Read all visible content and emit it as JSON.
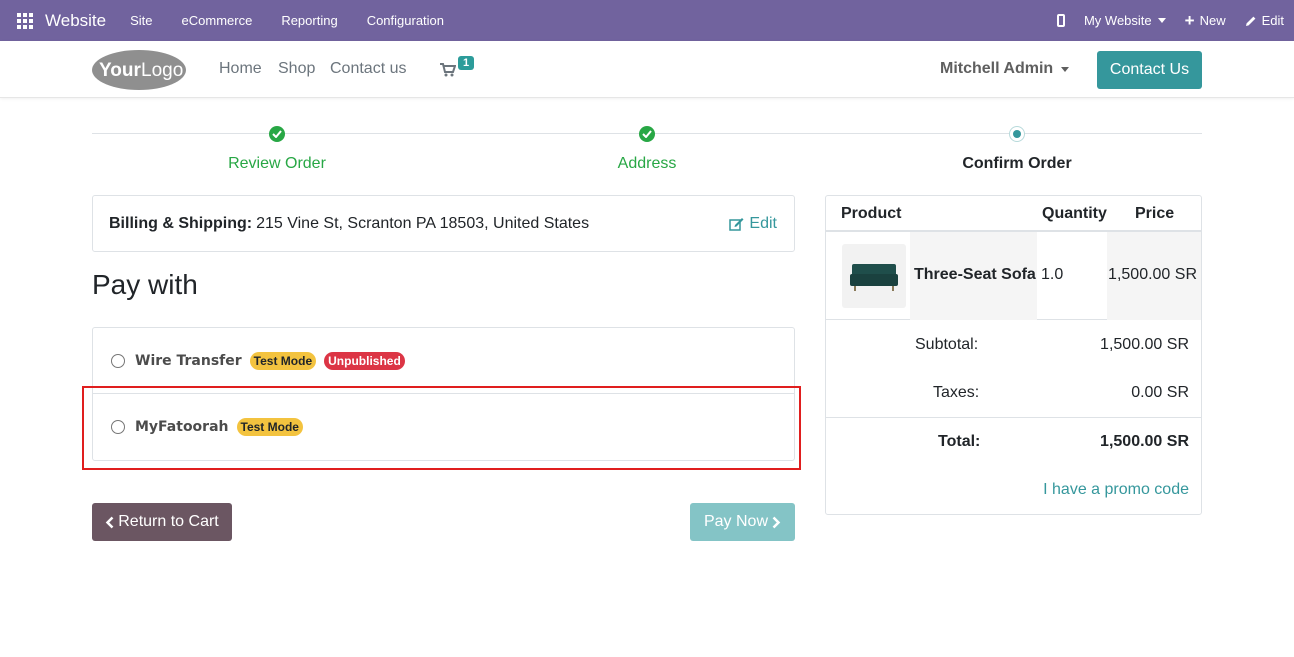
{
  "adminbar": {
    "app_name": "Website",
    "menus": [
      "Site",
      "eCommerce",
      "Reporting",
      "Configuration"
    ],
    "website_selector": "My Website",
    "new_label": "New",
    "edit_label": "Edit"
  },
  "header": {
    "logo_text": "YourLogo",
    "nav": [
      "Home",
      "Shop",
      "Contact us"
    ],
    "cart_count": "1",
    "user_name": "Mitchell Admin",
    "contact_button": "Contact Us"
  },
  "wizard": {
    "steps": [
      {
        "label": "Review Order",
        "state": "done"
      },
      {
        "label": "Address",
        "state": "done"
      },
      {
        "label": "Confirm Order",
        "state": "current"
      }
    ]
  },
  "billing": {
    "label": "Billing & Shipping:",
    "address": "215 Vine St, Scranton PA 18503, United States",
    "edit_label": "Edit"
  },
  "payment": {
    "title": "Pay with",
    "methods": [
      {
        "name": "Wire Transfer",
        "badges": [
          "Test Mode",
          "Unpublished"
        ]
      },
      {
        "name": "MyFatoorah",
        "badges": [
          "Test Mode"
        ]
      }
    ],
    "return_button": "Return to Cart",
    "pay_button": "Pay Now"
  },
  "summary": {
    "headers": [
      "Product",
      "Quantity",
      "Price"
    ],
    "line": {
      "product": "Three-Seat Sofa",
      "quantity": "1.0",
      "price": "1,500.00 SR"
    },
    "subtotal_label": "Subtotal:",
    "subtotal_value": "1,500.00 SR",
    "taxes_label": "Taxes:",
    "taxes_value": "0.00 SR",
    "total_label": "Total:",
    "total_value": "1,500.00 SR",
    "promo_link": "I have a promo code"
  },
  "colors": {
    "admin_bar": "#71639e",
    "accent": "#35979c",
    "success": "#28a745",
    "warning_badge": "#f3c33f",
    "danger_badge": "#dc3545",
    "return_button": "#6b5662",
    "highlight_box": "#e01e1e"
  }
}
